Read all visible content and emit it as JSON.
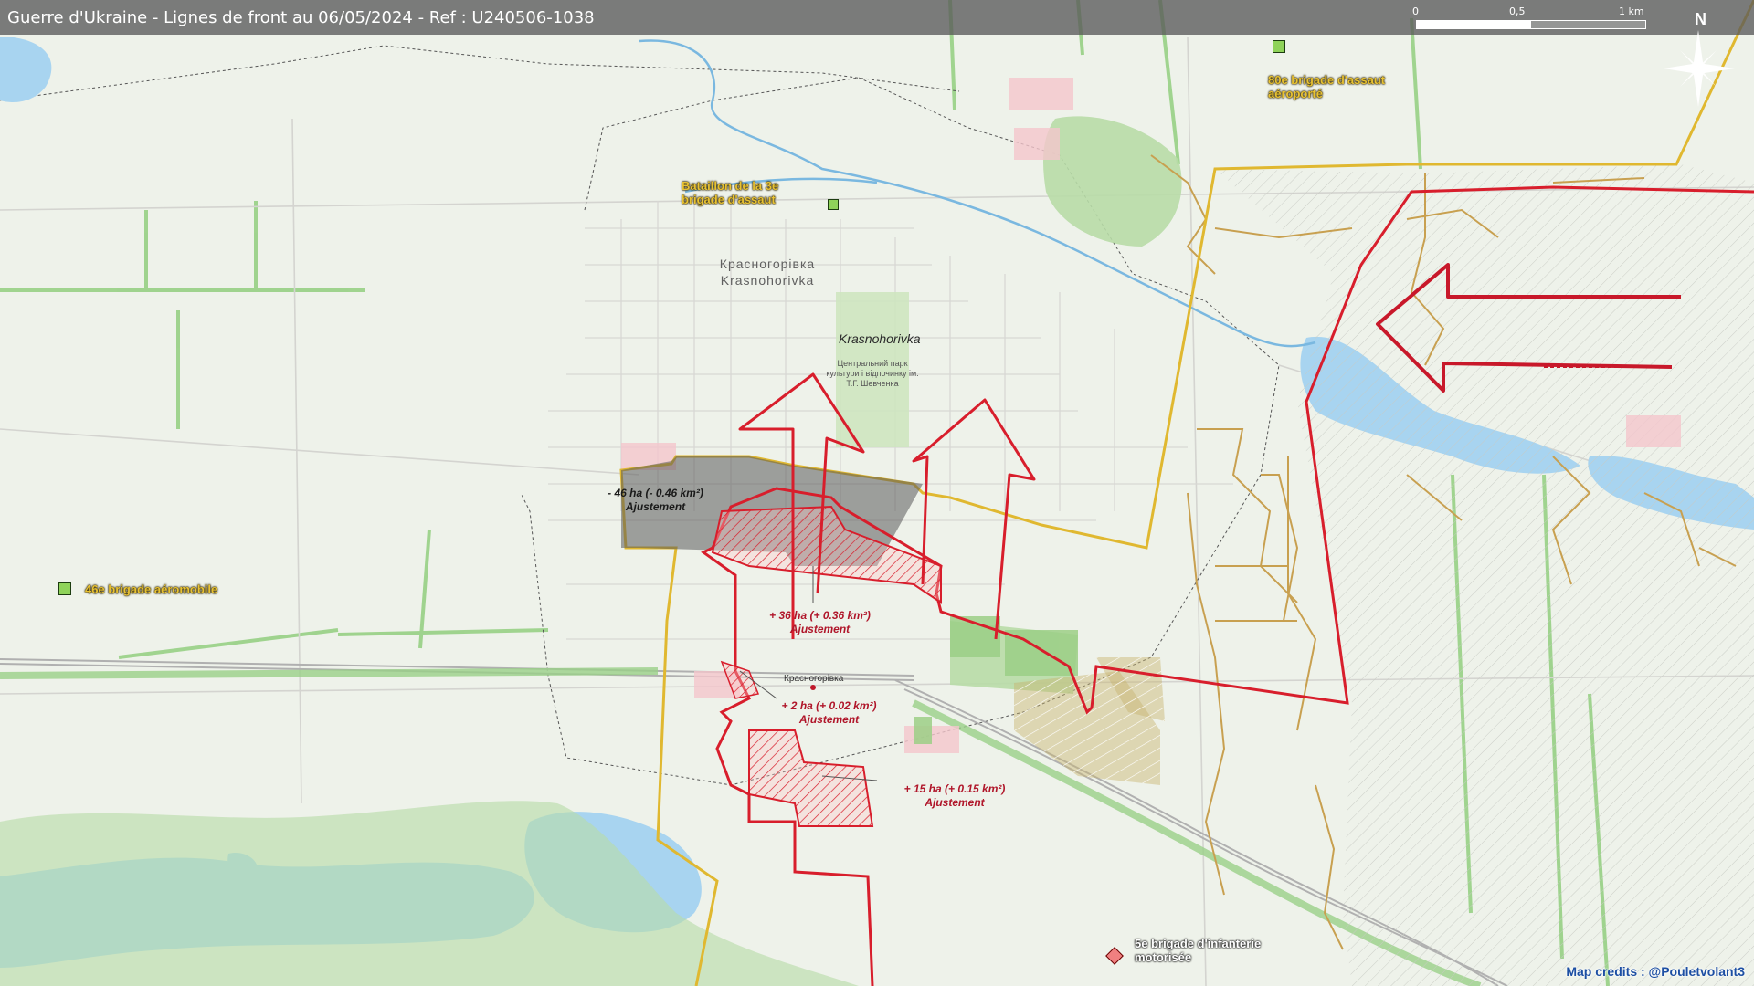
{
  "title": "Guerre d'Ukraine - Lignes de front au 06/05/2024 - Ref : U240506-1038",
  "scale": {
    "labels": [
      "0",
      "0,5",
      "1 km"
    ]
  },
  "compass": {
    "label": "N"
  },
  "city": {
    "cyrillic": "Красногорівка",
    "latin": "Krasnohorivka"
  },
  "park": {
    "name": "Krasnohorivka",
    "subtitle": "Центральний парк культури і відпочинку ім. Т.Г. Шевченка"
  },
  "station": {
    "name": "Красногорівка"
  },
  "units": {
    "brigade_80": "80e brigade d'assaut aéroporté",
    "battalion_3": "Bataillon de la 3e brigade d'assaut",
    "brigade_46": "46e brigade aéromobile",
    "brigade_5": "5e brigade d'infanterie motorisée"
  },
  "annotations": {
    "a1_value": "- 46 ha (- 0.46 km²)",
    "a1_label": "Ajustement",
    "a2_value": "+ 36 ha (+ 0.36 km²)",
    "a2_label": "Ajustement",
    "a3_value": "+ 2 ha (+ 0.02 km²)",
    "a3_label": "Ajustement",
    "a4_value": "+ 15 ha (+ 0.15 km²)",
    "a4_label": "Ajustement"
  },
  "credits": "Map credits : @Pouletvolant3",
  "colors": {
    "frontline_red": "#d81e2c",
    "ukraine_yellow": "#e0b830",
    "water": "#a8d4f0",
    "forest": "#b8dca8",
    "trench": "#c8a050"
  }
}
